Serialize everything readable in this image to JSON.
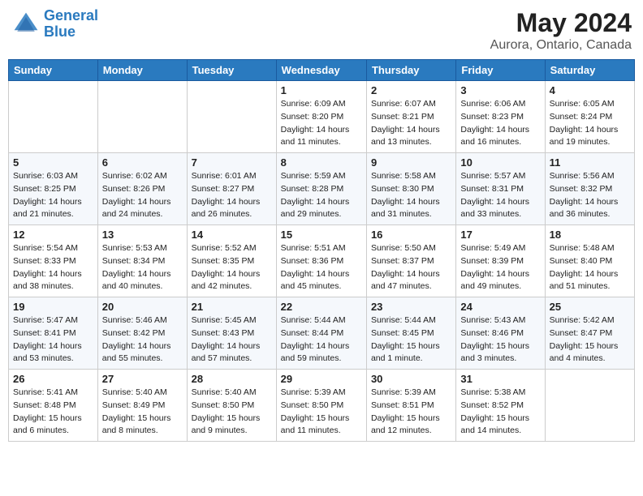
{
  "header": {
    "logo_line1": "General",
    "logo_line2": "Blue",
    "main_title": "May 2024",
    "subtitle": "Aurora, Ontario, Canada"
  },
  "weekdays": [
    "Sunday",
    "Monday",
    "Tuesday",
    "Wednesday",
    "Thursday",
    "Friday",
    "Saturday"
  ],
  "weeks": [
    [
      {
        "num": "",
        "info": ""
      },
      {
        "num": "",
        "info": ""
      },
      {
        "num": "",
        "info": ""
      },
      {
        "num": "1",
        "info": "Sunrise: 6:09 AM\nSunset: 8:20 PM\nDaylight: 14 hours\nand 11 minutes."
      },
      {
        "num": "2",
        "info": "Sunrise: 6:07 AM\nSunset: 8:21 PM\nDaylight: 14 hours\nand 13 minutes."
      },
      {
        "num": "3",
        "info": "Sunrise: 6:06 AM\nSunset: 8:23 PM\nDaylight: 14 hours\nand 16 minutes."
      },
      {
        "num": "4",
        "info": "Sunrise: 6:05 AM\nSunset: 8:24 PM\nDaylight: 14 hours\nand 19 minutes."
      }
    ],
    [
      {
        "num": "5",
        "info": "Sunrise: 6:03 AM\nSunset: 8:25 PM\nDaylight: 14 hours\nand 21 minutes."
      },
      {
        "num": "6",
        "info": "Sunrise: 6:02 AM\nSunset: 8:26 PM\nDaylight: 14 hours\nand 24 minutes."
      },
      {
        "num": "7",
        "info": "Sunrise: 6:01 AM\nSunset: 8:27 PM\nDaylight: 14 hours\nand 26 minutes."
      },
      {
        "num": "8",
        "info": "Sunrise: 5:59 AM\nSunset: 8:28 PM\nDaylight: 14 hours\nand 29 minutes."
      },
      {
        "num": "9",
        "info": "Sunrise: 5:58 AM\nSunset: 8:30 PM\nDaylight: 14 hours\nand 31 minutes."
      },
      {
        "num": "10",
        "info": "Sunrise: 5:57 AM\nSunset: 8:31 PM\nDaylight: 14 hours\nand 33 minutes."
      },
      {
        "num": "11",
        "info": "Sunrise: 5:56 AM\nSunset: 8:32 PM\nDaylight: 14 hours\nand 36 minutes."
      }
    ],
    [
      {
        "num": "12",
        "info": "Sunrise: 5:54 AM\nSunset: 8:33 PM\nDaylight: 14 hours\nand 38 minutes."
      },
      {
        "num": "13",
        "info": "Sunrise: 5:53 AM\nSunset: 8:34 PM\nDaylight: 14 hours\nand 40 minutes."
      },
      {
        "num": "14",
        "info": "Sunrise: 5:52 AM\nSunset: 8:35 PM\nDaylight: 14 hours\nand 42 minutes."
      },
      {
        "num": "15",
        "info": "Sunrise: 5:51 AM\nSunset: 8:36 PM\nDaylight: 14 hours\nand 45 minutes."
      },
      {
        "num": "16",
        "info": "Sunrise: 5:50 AM\nSunset: 8:37 PM\nDaylight: 14 hours\nand 47 minutes."
      },
      {
        "num": "17",
        "info": "Sunrise: 5:49 AM\nSunset: 8:39 PM\nDaylight: 14 hours\nand 49 minutes."
      },
      {
        "num": "18",
        "info": "Sunrise: 5:48 AM\nSunset: 8:40 PM\nDaylight: 14 hours\nand 51 minutes."
      }
    ],
    [
      {
        "num": "19",
        "info": "Sunrise: 5:47 AM\nSunset: 8:41 PM\nDaylight: 14 hours\nand 53 minutes."
      },
      {
        "num": "20",
        "info": "Sunrise: 5:46 AM\nSunset: 8:42 PM\nDaylight: 14 hours\nand 55 minutes."
      },
      {
        "num": "21",
        "info": "Sunrise: 5:45 AM\nSunset: 8:43 PM\nDaylight: 14 hours\nand 57 minutes."
      },
      {
        "num": "22",
        "info": "Sunrise: 5:44 AM\nSunset: 8:44 PM\nDaylight: 14 hours\nand 59 minutes."
      },
      {
        "num": "23",
        "info": "Sunrise: 5:44 AM\nSunset: 8:45 PM\nDaylight: 15 hours\nand 1 minute."
      },
      {
        "num": "24",
        "info": "Sunrise: 5:43 AM\nSunset: 8:46 PM\nDaylight: 15 hours\nand 3 minutes."
      },
      {
        "num": "25",
        "info": "Sunrise: 5:42 AM\nSunset: 8:47 PM\nDaylight: 15 hours\nand 4 minutes."
      }
    ],
    [
      {
        "num": "26",
        "info": "Sunrise: 5:41 AM\nSunset: 8:48 PM\nDaylight: 15 hours\nand 6 minutes."
      },
      {
        "num": "27",
        "info": "Sunrise: 5:40 AM\nSunset: 8:49 PM\nDaylight: 15 hours\nand 8 minutes."
      },
      {
        "num": "28",
        "info": "Sunrise: 5:40 AM\nSunset: 8:50 PM\nDaylight: 15 hours\nand 9 minutes."
      },
      {
        "num": "29",
        "info": "Sunrise: 5:39 AM\nSunset: 8:50 PM\nDaylight: 15 hours\nand 11 minutes."
      },
      {
        "num": "30",
        "info": "Sunrise: 5:39 AM\nSunset: 8:51 PM\nDaylight: 15 hours\nand 12 minutes."
      },
      {
        "num": "31",
        "info": "Sunrise: 5:38 AM\nSunset: 8:52 PM\nDaylight: 15 hours\nand 14 minutes."
      },
      {
        "num": "",
        "info": ""
      }
    ]
  ]
}
